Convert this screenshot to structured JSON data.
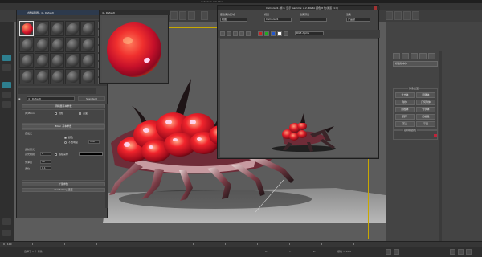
{
  "app": {
    "title": "Autodesk 3ds Max"
  },
  "material_editor": {
    "title": "材质编辑器 - 4 - Default",
    "material_name": "4 - Default",
    "material_type": "Standard",
    "rollout_basic": "明暗器基本参数",
    "rollout_blinn": "Blinn 基本参数",
    "self_illum_label": "自发光",
    "color_label": "颜色",
    "opacity_label": "不透明度",
    "opacity_value": "100",
    "spec_label": "反射高光",
    "spec_level_label": "高光级别",
    "spec_level_value": "0",
    "gloss_label": "光泽度",
    "gloss_value": "10",
    "soften_label": "柔化",
    "soften_value": "0.1",
    "mentalray_label": "mental ray 连接",
    "extended_label": "扩展参数",
    "supersampling_label": "超级采样",
    "wire_label": "线框",
    "two_sided_label": "双面"
  },
  "preview_window": {
    "title": "4 - Default"
  },
  "render_window": {
    "title": "Camera01, 帧 0, 显示 Gamma: 2.2, RGBA 颜色 8 位/通道 (1:1)",
    "area_label": "要渲染的区域",
    "area_value": "视图",
    "viewport_label": "视口",
    "viewport_value": "Camera01",
    "preset_label": "渲染预设",
    "preset_value": "",
    "render_button": "渲染",
    "production_value": "产品级",
    "channel_value": "RGB Alpha"
  },
  "command_panel": {
    "object_type": "标准基本体",
    "group_title": "对象类型",
    "buttons": [
      "长方体",
      "圆锥体",
      "球体",
      "几何球体",
      "圆柱体",
      "管状体",
      "圆环",
      "四棱锥",
      "茶壶",
      "平面"
    ],
    "name_color_title": "名称和颜色",
    "accent_color": "#c0233a"
  },
  "statusbar": {
    "selection_text": "选择了 1 个 对象",
    "frame_text": "0 / 100",
    "x_label": "X:",
    "y_label": "Y:",
    "z_label": "Z:",
    "grid_text": "栅格 = 10.0"
  },
  "colors": {
    "accent_red": "#d6162c",
    "viewport_frame": "#c8a800"
  }
}
